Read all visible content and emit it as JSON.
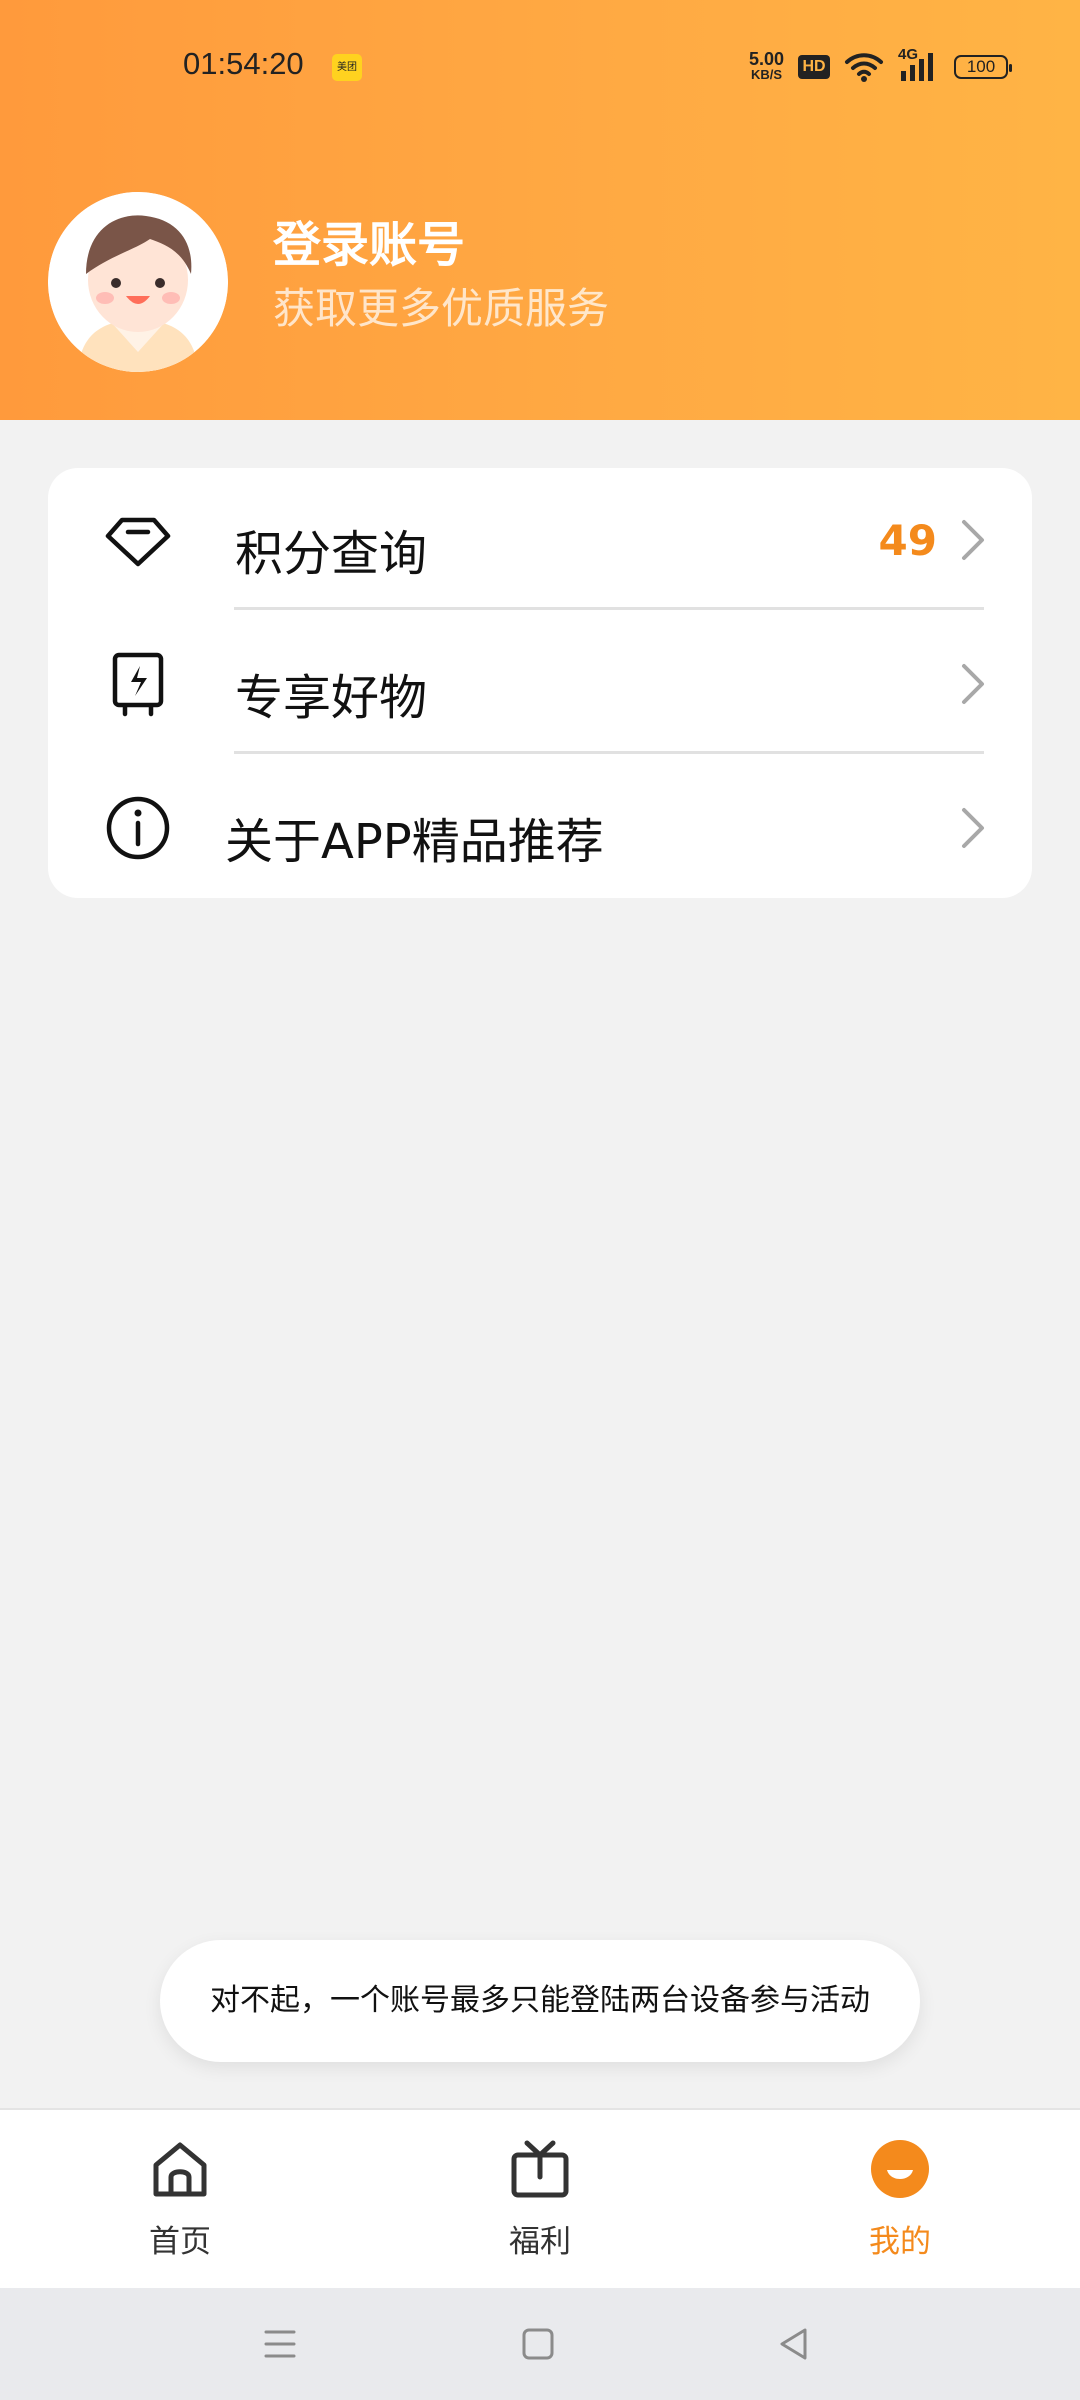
{
  "status_bar": {
    "time": "01:54:20",
    "notification_app": "美团",
    "network_speed": "5.00",
    "speed_unit": "KB/S",
    "hd_label": "HD",
    "signal_type": "4G",
    "battery": "100"
  },
  "profile": {
    "title": "登录账号",
    "subtitle": "获取更多优质服务"
  },
  "menu": {
    "items": [
      {
        "label": "积分查询",
        "value": "49",
        "icon": "diamond-icon"
      },
      {
        "label": "专享好物",
        "value": "",
        "icon": "tablet-lightning-icon"
      },
      {
        "label": "关于APP精品推荐",
        "value": "",
        "icon": "info-icon"
      }
    ]
  },
  "toast": {
    "message": "对不起，一个账号最多只能登陆两台设备参与活动"
  },
  "tabs": [
    {
      "label": "首页",
      "icon": "home-icon"
    },
    {
      "label": "福利",
      "icon": "tv-gift-icon"
    },
    {
      "label": "我的",
      "icon": "profile-face-icon",
      "active": true
    }
  ],
  "colors": {
    "header_start": "#ff9a3c",
    "header_end": "#ffb445",
    "accent": "#f48a1c",
    "background": "#f2f2f2"
  }
}
